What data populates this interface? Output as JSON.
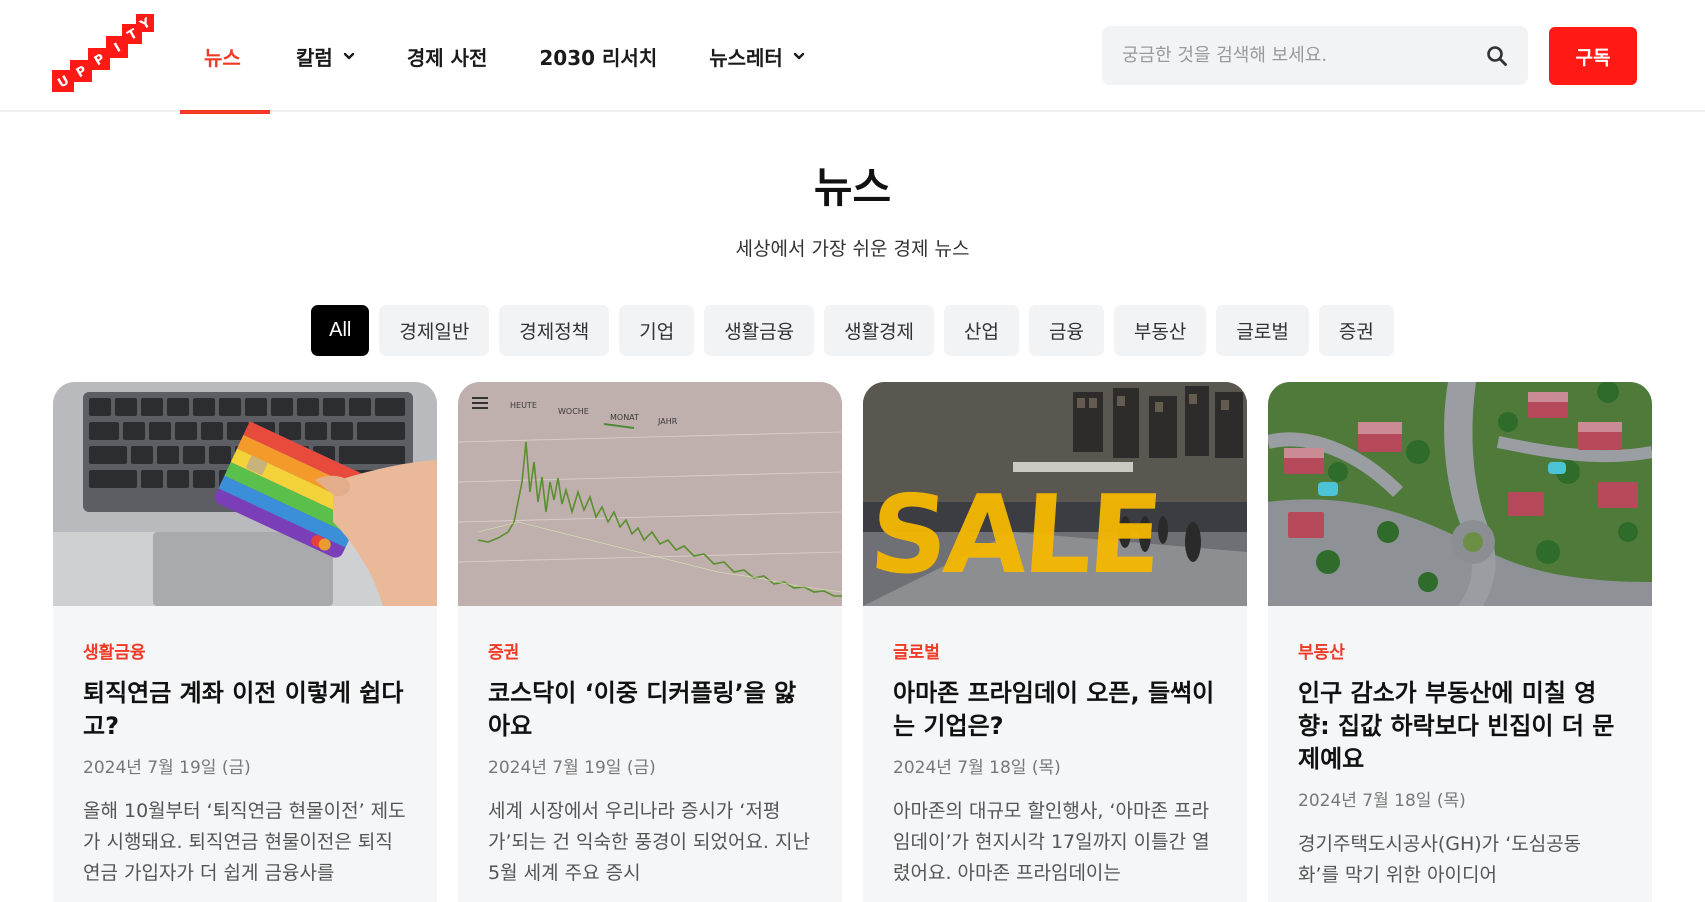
{
  "header": {
    "logo_text": "UPPITY",
    "nav": [
      {
        "label": "뉴스",
        "active": true,
        "has_dropdown": false
      },
      {
        "label": "칼럼",
        "active": false,
        "has_dropdown": true
      },
      {
        "label": "경제 사전",
        "active": false,
        "has_dropdown": false
      },
      {
        "label": "2030 리서치",
        "active": false,
        "has_dropdown": false
      },
      {
        "label": "뉴스레터",
        "active": false,
        "has_dropdown": true
      }
    ],
    "search_placeholder": "궁금한 것을 검색해 보세요.",
    "subscribe_label": "구독"
  },
  "page": {
    "title": "뉴스",
    "subtitle": "세상에서 가장 쉬운 경제 뉴스"
  },
  "filters": {
    "items": [
      "All",
      "경제일반",
      "경제정책",
      "기업",
      "생활금융",
      "생활경제",
      "산업",
      "금융",
      "부동산",
      "글로벌",
      "증권"
    ],
    "selected": "All"
  },
  "cards": [
    {
      "category": "생활금융",
      "title": "퇴직연금 계좌 이전 이렇게 쉽다고?",
      "date": "2024년 7월 19일 (금)",
      "excerpt": "올해 10월부터 ‘퇴직연금 현물이전’ 제도가 시행돼요. 퇴직연금 현물이전은 퇴직연금 가입자가 더 쉽게 금융사를"
    },
    {
      "category": "증권",
      "title": "코스닥이 ‘이중 디커플링’을 앓아요",
      "date": "2024년 7월 19일 (금)",
      "excerpt": "세계 시장에서 우리나라 증시가 ‘저평가’되는 건 익숙한 풍경이 되었어요. 지난 5월 세계 주요 증시"
    },
    {
      "category": "글로벌",
      "title": "아마존 프라임데이 오픈, 들썩이는 기업은?",
      "date": "2024년 7월 18일 (목)",
      "excerpt": "아마존의 대규모 할인행사, ‘아마존 프라임데이’가 현지시각 17일까지 이틀간 열렸어요. 아마존 프라임데이는"
    },
    {
      "category": "부동산",
      "title": "인구 감소가 부동산에 미칠 영향: 집값 하락보다 빈집이 더 문제예요",
      "date": "2024년 7월 18일 (목)",
      "excerpt": "경기주택도시공사(GH)가 ‘도심공동화’를 막기 위한 아이디어"
    }
  ],
  "thumb_texts": {
    "chart_tabs": [
      "HEUTE",
      "WOCHE",
      "MONAT",
      "JAHR"
    ],
    "sale_sign": "SALE"
  },
  "colors": {
    "accent": "#f03a25",
    "subscribe_bg": "#ff1a16",
    "chip_bg": "#f2f3f5",
    "card_bg": "#f5f6f7"
  }
}
